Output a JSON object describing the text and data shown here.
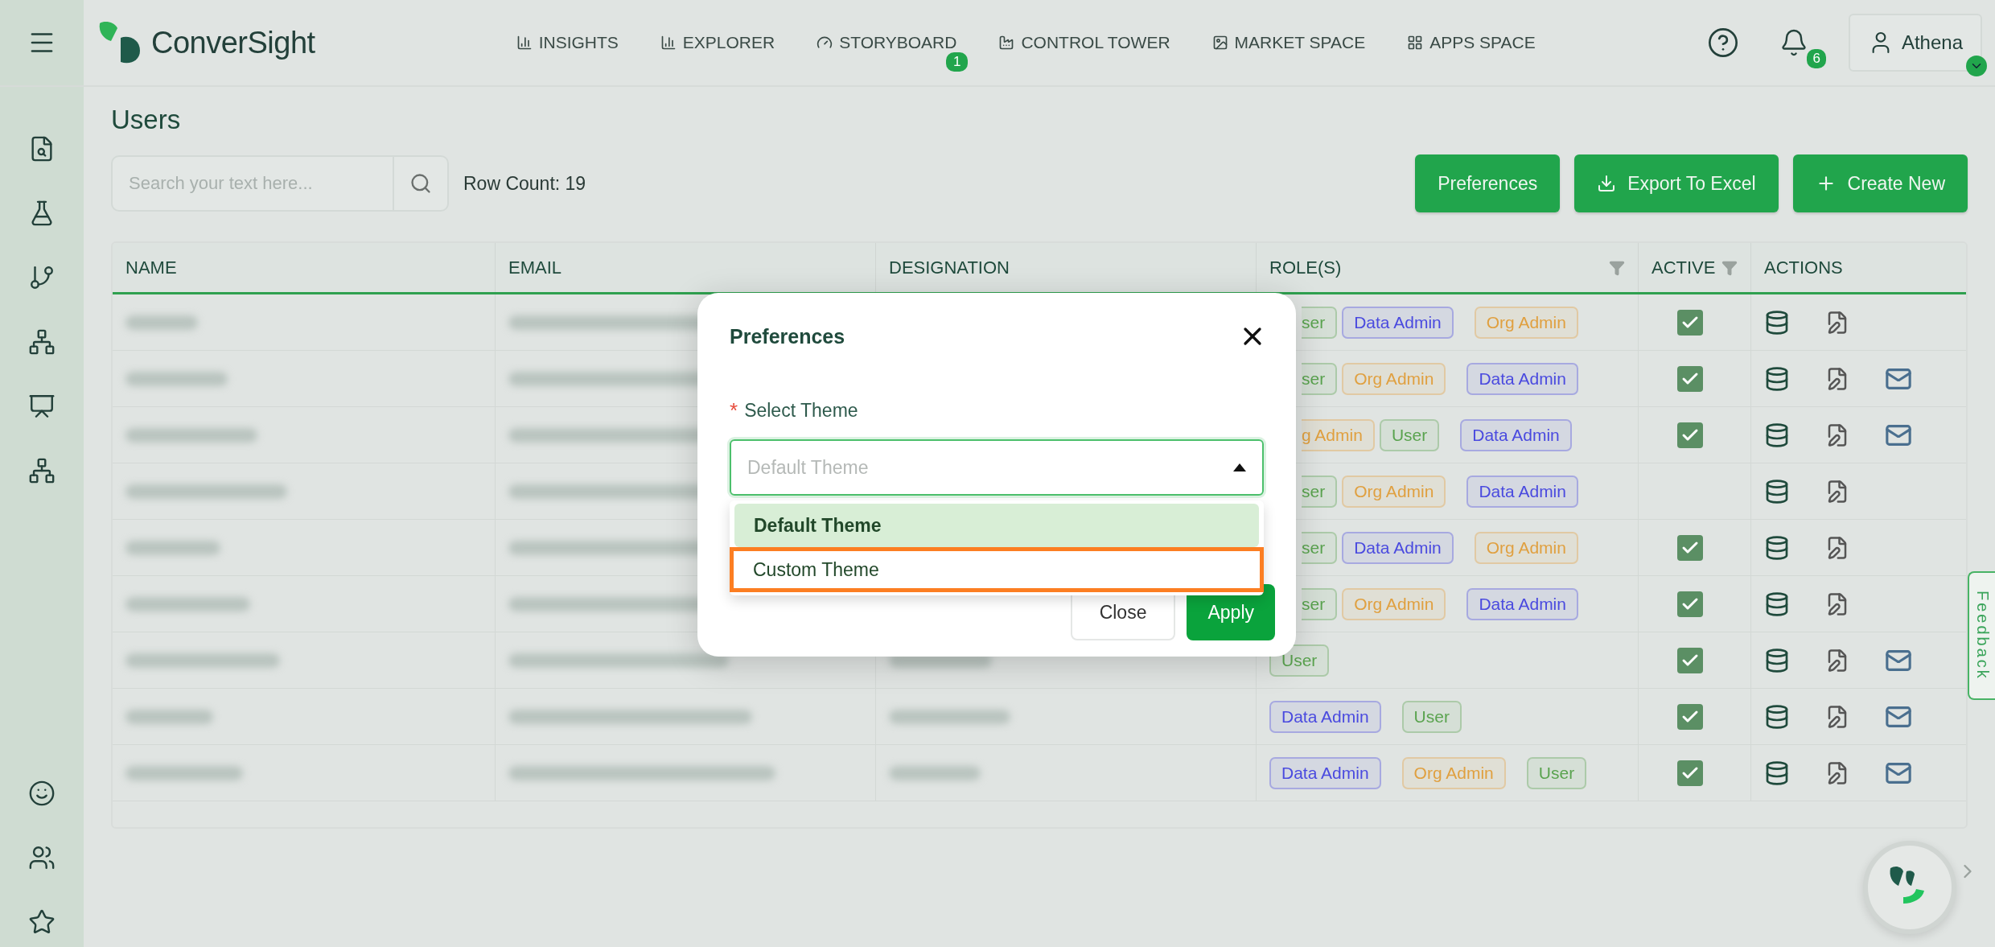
{
  "header": {
    "logo_text": "ConverSight",
    "nav": [
      {
        "label": "INSIGHTS"
      },
      {
        "label": "EXPLORER"
      },
      {
        "label": "STORYBOARD",
        "badge": "1"
      },
      {
        "label": "CONTROL TOWER"
      },
      {
        "label": "MARKET SPACE"
      },
      {
        "label": "APPS SPACE"
      }
    ],
    "notifications": "6",
    "user": "Athena"
  },
  "page": {
    "title": "Users",
    "search": {
      "placeholder": "Search your text here..."
    },
    "row_count": "Row Count: 19",
    "buttons": [
      {
        "label": "Preferences"
      },
      {
        "label": "Export To Excel"
      },
      {
        "label": "Create New"
      }
    ]
  },
  "table": {
    "columns": [
      {
        "label": "NAME",
        "filter": false
      },
      {
        "label": "EMAIL",
        "filter": false
      },
      {
        "label": "DESIGNATION",
        "filter": false
      },
      {
        "label": "ROLE(S)",
        "filter": true
      },
      {
        "label": "ACTIVE",
        "filter": true
      },
      {
        "label": "ACTIONS",
        "filter": false
      }
    ],
    "rows": [
      {
        "roles": [
          {
            "label": "ser",
            "color": "#5aa34f",
            "cut": true
          },
          {
            "label": "Data Admin",
            "color": "#4a4adf",
            "cut": false
          },
          {
            "label": "Org Admin",
            "color": "#e0a040",
            "cut": false
          }
        ],
        "active": true,
        "mail": false
      },
      {
        "roles": [
          {
            "label": "ser",
            "color": "#5aa34f",
            "cut": true
          },
          {
            "label": "Org Admin",
            "color": "#e0a040",
            "cut": false
          },
          {
            "label": "Data Admin",
            "color": "#4a4adf",
            "cut": false
          }
        ],
        "active": true,
        "mail": true
      },
      {
        "roles": [
          {
            "label": "g Admin",
            "color": "#e0a040",
            "cut": true
          },
          {
            "label": "User",
            "color": "#5aa34f",
            "cut": false
          },
          {
            "label": "Data Admin",
            "color": "#4a4adf",
            "cut": false
          }
        ],
        "active": true,
        "mail": true
      },
      {
        "roles": [
          {
            "label": "ser",
            "color": "#5aa34f",
            "cut": true
          },
          {
            "label": "Org Admin",
            "color": "#e0a040",
            "cut": false
          },
          {
            "label": "Data Admin",
            "color": "#4a4adf",
            "cut": false
          }
        ],
        "active": false,
        "mail": false
      },
      {
        "roles": [
          {
            "label": "ser",
            "color": "#5aa34f",
            "cut": true
          },
          {
            "label": "Data Admin",
            "color": "#4a4adf",
            "cut": false
          },
          {
            "label": "Org Admin",
            "color": "#e0a040",
            "cut": false
          }
        ],
        "active": true,
        "mail": false
      },
      {
        "roles": [
          {
            "label": "ser",
            "color": "#5aa34f",
            "cut": true
          },
          {
            "label": "Org Admin",
            "color": "#e0a040",
            "cut": false
          },
          {
            "label": "Data Admin",
            "color": "#4a4adf",
            "cut": false
          }
        ],
        "active": true,
        "mail": false
      },
      {
        "roles": [
          {
            "label": "User",
            "color": "#5aa34f",
            "cut": false
          }
        ],
        "active": true,
        "mail": true
      },
      {
        "roles": [
          {
            "label": "Data Admin",
            "color": "#4a4adf",
            "cut": false
          },
          {
            "label": "User",
            "color": "#5aa34f",
            "cut": false
          }
        ],
        "active": true,
        "mail": true
      },
      {
        "roles": [
          {
            "label": "Data Admin",
            "color": "#4a4adf",
            "cut": false
          },
          {
            "label": "Org Admin",
            "color": "#e0a040",
            "cut": false
          },
          {
            "label": "User",
            "color": "#5aa34f",
            "cut": false
          }
        ],
        "active": true,
        "mail": true
      }
    ]
  },
  "feedback": "Feedback",
  "modal": {
    "title": "Preferences",
    "required_mark": "*",
    "field_label": "Select Theme",
    "select": {
      "placeholder": "Default Theme",
      "open": true
    },
    "options": [
      {
        "label": "Default Theme",
        "selected": true,
        "highlighted": false
      },
      {
        "label": "Custom Theme",
        "selected": false,
        "highlighted": true
      }
    ],
    "buttons": [
      {
        "label": "Close",
        "kind": "secondary"
      },
      {
        "label": "Apply",
        "kind": "primary"
      }
    ]
  }
}
